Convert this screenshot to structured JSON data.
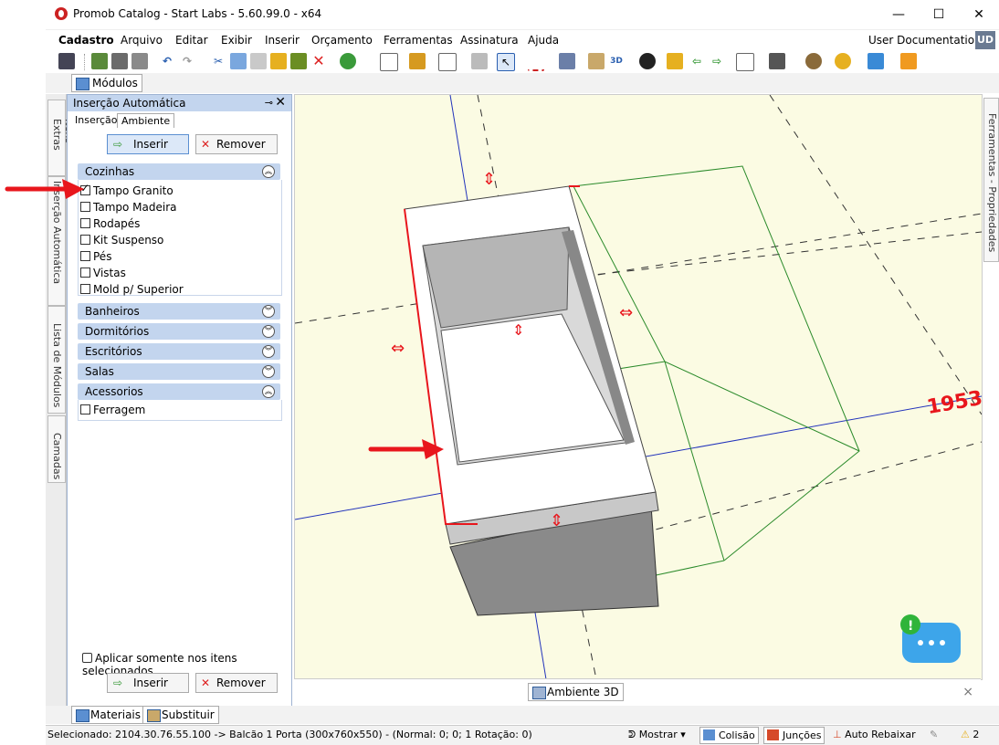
{
  "window": {
    "title": "Promob Catalog - Start Labs - 5.60.99.0 - x64",
    "controls": {
      "minimize": "—",
      "maximize": "☐",
      "close": "✕"
    }
  },
  "menu": {
    "items": [
      "Cadastro",
      "Arquivo",
      "Editar",
      "Exibir",
      "Inserir",
      "Orçamento",
      "Ferramentas",
      "Assinatura",
      "Ajuda"
    ],
    "user_label": "User Documentation",
    "user_initials": "UD"
  },
  "module_tab": {
    "label": "Módulos"
  },
  "left_strip": {
    "tabs": [
      "Itens Extras",
      "Inserção Automática",
      "Lista de Módulos",
      "Camadas"
    ]
  },
  "panel": {
    "title": "Inserção Automática",
    "tabs": [
      "Inserção",
      "Ambiente"
    ],
    "active_tab": "Ambiente",
    "insert_label": "Inserir",
    "remove_label": "Remover",
    "groups": [
      {
        "name": "Cozinhas",
        "expanded": true,
        "items": [
          {
            "label": "Tampo Granito",
            "checked": true
          },
          {
            "label": "Tampo Madeira",
            "checked": false
          },
          {
            "label": "Rodapés",
            "checked": false
          },
          {
            "label": "Kit Suspenso",
            "checked": false
          },
          {
            "label": "Pés",
            "checked": false
          },
          {
            "label": "Vistas",
            "checked": false
          },
          {
            "label": "Mold p/ Superior",
            "checked": false
          }
        ]
      },
      {
        "name": "Banheiros",
        "expanded": false
      },
      {
        "name": "Dormitórios",
        "expanded": false
      },
      {
        "name": "Escritórios",
        "expanded": false
      },
      {
        "name": "Salas",
        "expanded": false
      },
      {
        "name": "Acessorios",
        "expanded": true,
        "items": [
          {
            "label": "Ferragem",
            "checked": false
          }
        ]
      }
    ],
    "apply_selected_label": "Aplicar somente nos itens selecionados",
    "bottom_insert_label": "Inserir",
    "bottom_remove_label": "Remover"
  },
  "viewport": {
    "dimension_label": "1953",
    "view_tab_label": "Ambiente 3D",
    "close_label": "×"
  },
  "right_strip": {
    "label": "Ferramentas - Propriedades"
  },
  "bottom_tabs": [
    "Materiais",
    "Substituir"
  ],
  "status": {
    "selected": "Selecionado: 2104.30.76.55.100 -> Balcão 1 Porta (300x760x550) - (Normal: 0; 0; 1 Rotação: 0)",
    "show_label": "Mostrar",
    "collision_label": "Colisão",
    "joints_label": "Junções",
    "auto_lower_label": "Auto Rebaixar",
    "warning_count": "2"
  },
  "colors": {
    "accent": "#c3d5ee",
    "viewport_bg": "#fbfbe3",
    "annotation": "#e8161c"
  }
}
